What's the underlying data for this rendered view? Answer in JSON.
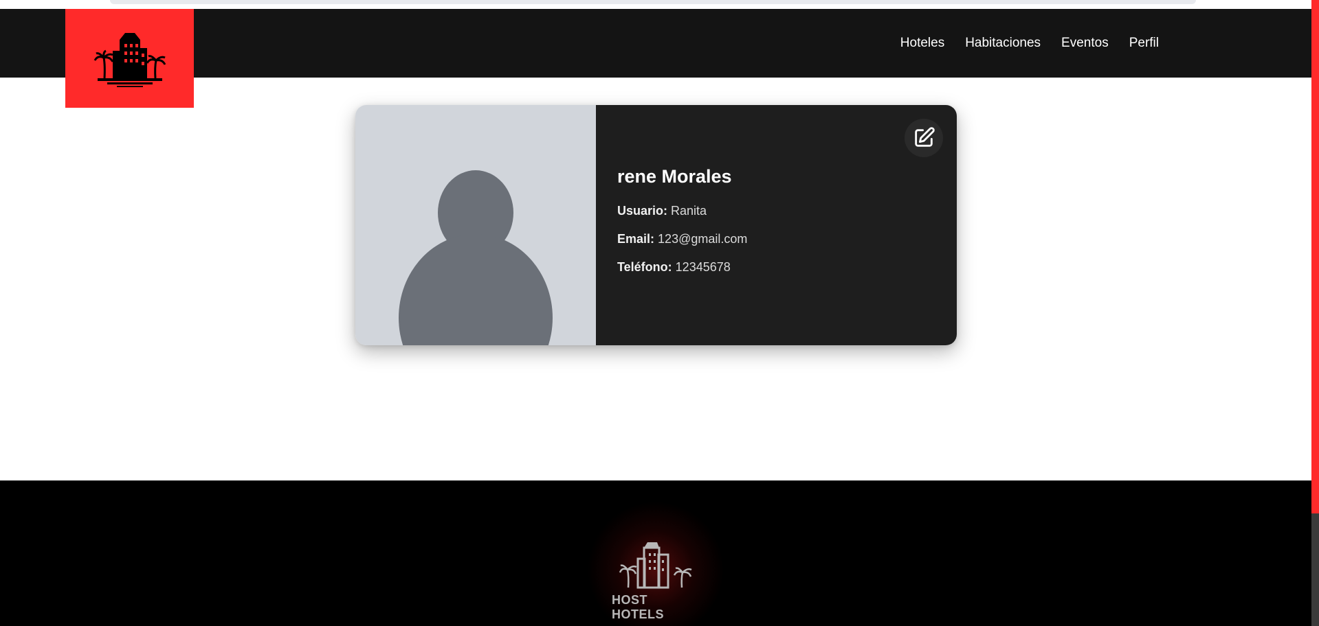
{
  "navbar": {
    "links": [
      {
        "label": "Hoteles"
      },
      {
        "label": "Habitaciones"
      },
      {
        "label": "Eventos"
      },
      {
        "label": "Perfil"
      }
    ]
  },
  "profile": {
    "name": "rene Morales",
    "fields": [
      {
        "label": "Usuario:",
        "value": "Ranita"
      },
      {
        "label": "Email:",
        "value": "123@gmail.com"
      },
      {
        "label": "Teléfono:",
        "value": "12345678"
      }
    ],
    "edit_icon": "edit-icon",
    "avatar_icon": "user-placeholder-icon"
  },
  "footer": {
    "brand": "HOST HOTELS"
  },
  "colors": {
    "accent": "#ff2a2a",
    "navbar_bg": "#141414",
    "card_info_bg": "#1e1e1e",
    "photo_bg": "#d1d5db",
    "avatar": "#6b7078",
    "footer_bg": "#000000"
  }
}
